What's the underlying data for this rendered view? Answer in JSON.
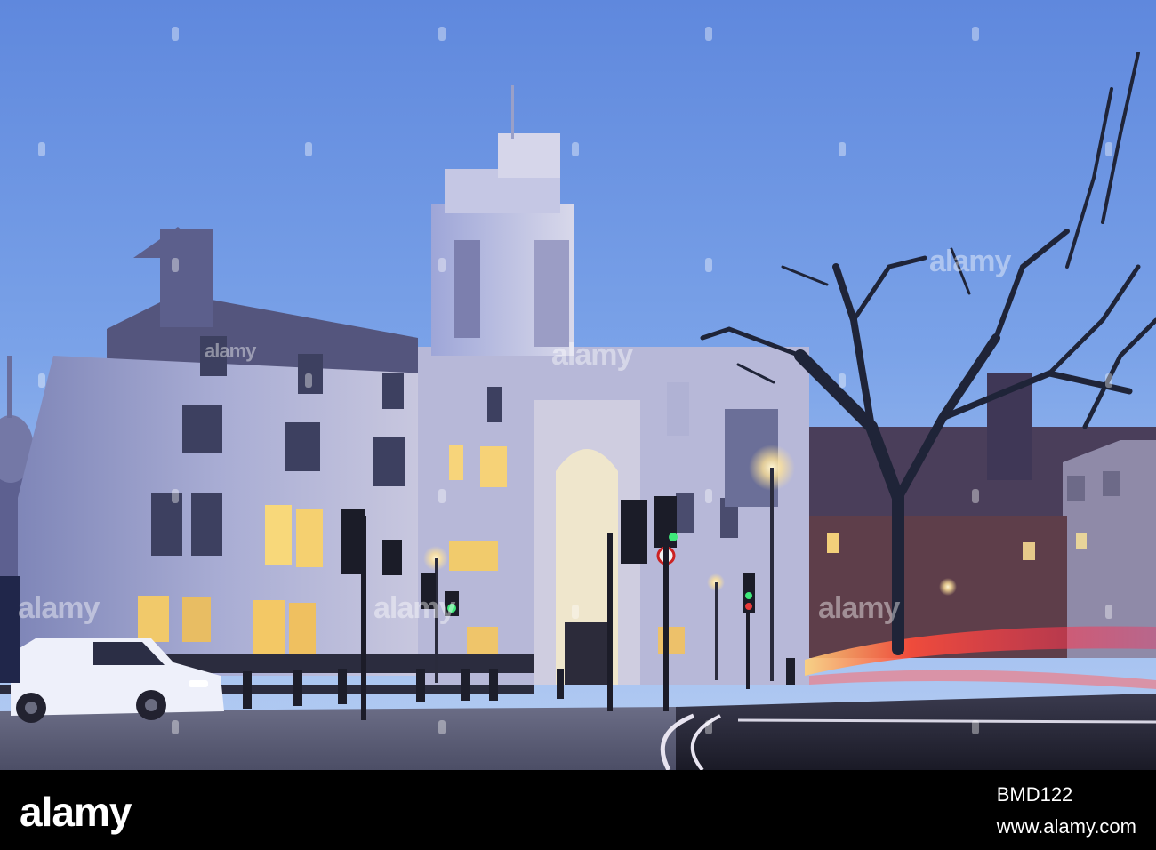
{
  "watermark": {
    "text": "alamy"
  },
  "footer": {
    "logo": "alamy",
    "url": "www.alamy.com",
    "image_id": "BMD122"
  }
}
